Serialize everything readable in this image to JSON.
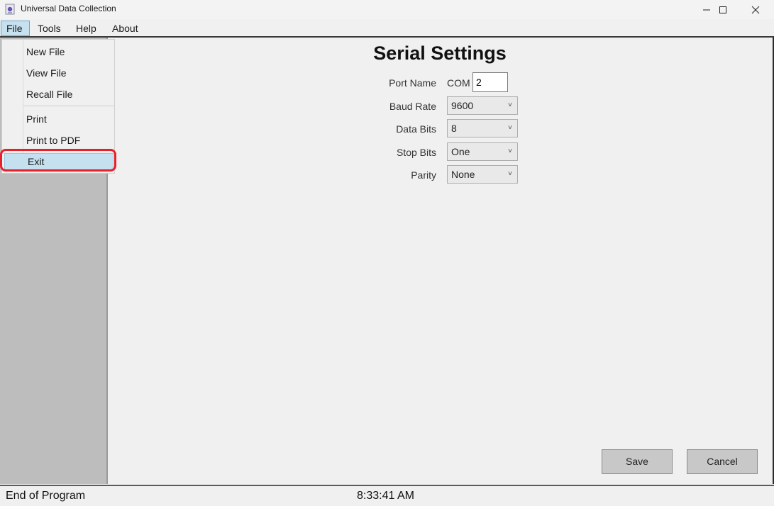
{
  "window": {
    "title": "Universal Data Collection"
  },
  "icons": {
    "app": "app-icon",
    "minimize": "minimize-icon",
    "maximize": "maximize-icon",
    "close": "close-icon",
    "dropdown_arrow": "chevron-down-icon"
  },
  "menubar": {
    "items": [
      "File",
      "Tools",
      "Help",
      "About"
    ],
    "active": "File"
  },
  "file_menu": {
    "items": [
      "New File",
      "View File",
      "Recall File",
      "Print",
      "Print to PDF",
      "Exit"
    ],
    "highlighted": "Exit"
  },
  "serial_settings": {
    "heading": "Serial Settings",
    "port_name": {
      "label": "Port Name",
      "prefix": "COM",
      "value": "2"
    },
    "baud_rate": {
      "label": "Baud Rate",
      "value": "9600"
    },
    "data_bits": {
      "label": "Data Bits",
      "value": "8"
    },
    "stop_bits": {
      "label": "Stop Bits",
      "value": "One"
    },
    "parity": {
      "label": "Parity",
      "value": "None"
    }
  },
  "buttons": {
    "save": "Save",
    "cancel": "Cancel"
  },
  "status": {
    "message": "End of Program",
    "time": "8:33:41 AM"
  },
  "colors": {
    "highlight_ring": "#e8202a",
    "menu_selected": "#c5e0ef"
  }
}
